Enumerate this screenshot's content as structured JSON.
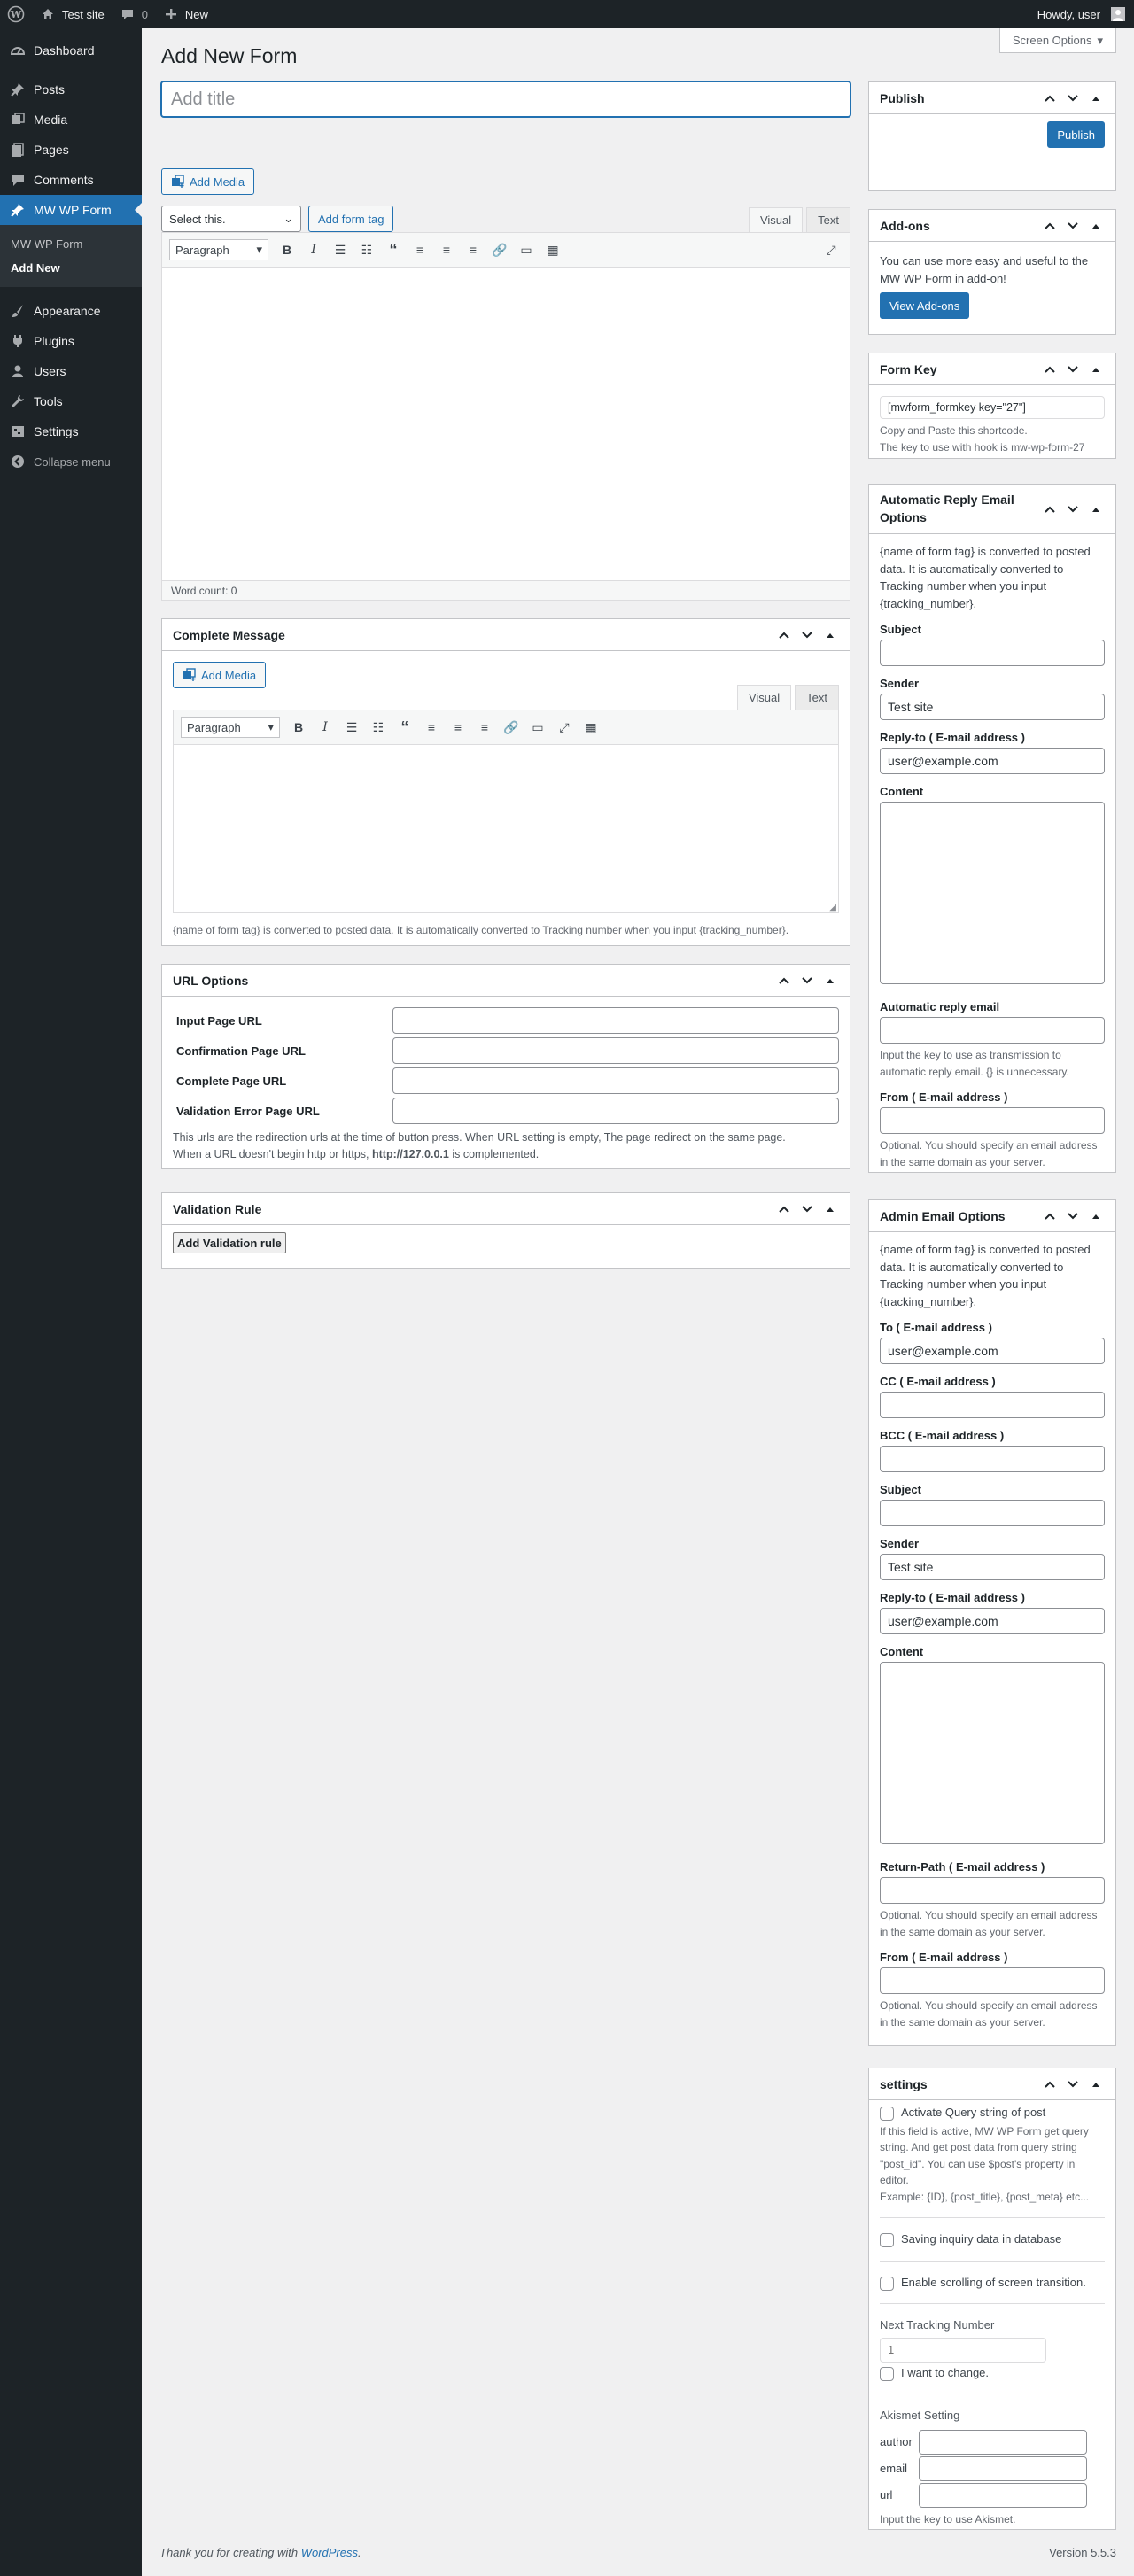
{
  "adminbar": {
    "site_name": "Test site",
    "comments_count": "0",
    "new_label": "New",
    "howdy": "Howdy, user"
  },
  "sidebar": {
    "items": [
      {
        "label": "Dashboard",
        "icon": "dashboard-icon"
      },
      {
        "label": "Posts",
        "icon": "pin-icon"
      },
      {
        "label": "Media",
        "icon": "media-icon"
      },
      {
        "label": "Pages",
        "icon": "page-icon"
      },
      {
        "label": "Comments",
        "icon": "comment-icon"
      },
      {
        "label": "MW WP Form",
        "icon": "pin-icon"
      },
      {
        "label": "Appearance",
        "icon": "brush-icon"
      },
      {
        "label": "Plugins",
        "icon": "plugin-icon"
      },
      {
        "label": "Users",
        "icon": "users-icon"
      },
      {
        "label": "Tools",
        "icon": "wrench-icon"
      },
      {
        "label": "Settings",
        "icon": "settings-icon"
      }
    ],
    "submenu": [
      "MW WP Form",
      "Add New"
    ],
    "collapse": "Collapse menu"
  },
  "page": {
    "screen_options": "Screen Options",
    "heading": "Add New Form",
    "title_placeholder": "Add title",
    "add_media": "Add Media",
    "select_placeholder": "Select this.",
    "add_form_tag": "Add form tag",
    "tab_visual": "Visual",
    "tab_text": "Text",
    "paragraph": "Paragraph",
    "word_count": "Word count: 0"
  },
  "complete_message": {
    "title": "Complete Message",
    "add_media": "Add Media",
    "tab_visual": "Visual",
    "tab_text": "Text",
    "paragraph": "Paragraph",
    "note": "{name of form tag} is converted to posted data. It is automatically converted to Tracking number when you input {tracking_number}."
  },
  "url_options": {
    "title": "URL Options",
    "rows": [
      "Input Page URL",
      "Confirmation Page URL",
      "Complete Page URL",
      "Validation Error Page URL"
    ],
    "note_1": "This urls are the redirection urls at the time of button press. When URL setting is empty, The page redirect on the same page.",
    "note_2": "When a URL doesn't begin http or https,",
    "note_host": "http://127.0.0.1",
    "note_3": "is complemented."
  },
  "validation": {
    "title": "Validation Rule",
    "button": "Add Validation rule"
  },
  "publish": {
    "title": "Publish",
    "button": "Publish"
  },
  "addons": {
    "title": "Add-ons",
    "text": "You can use more easy and useful to the MW WP Form in add-on!",
    "button": "View Add-ons"
  },
  "form_key": {
    "title": "Form Key",
    "value": "[mwform_formkey key=\"27\"]",
    "desc_1": "Copy and Paste this shortcode.",
    "desc_2": "The key to use with hook is mw-wp-form-27"
  },
  "auto_reply": {
    "title": "Automatic Reply Email Options",
    "intro": "{name of form tag} is converted to posted data. It is automatically converted to Tracking number when you input {tracking_number}.",
    "subject_label": "Subject",
    "subject_value": "",
    "sender_label": "Sender",
    "sender_value": "Test site",
    "reply_to_label": "Reply-to ( E-mail address )",
    "reply_to_value": "user@example.com",
    "content_label": "Content",
    "auto_email_label": "Automatic reply email",
    "auto_email_desc": "Input the key to use as transmission to automatic reply email. {} is unnecessary.",
    "from_label": "From ( E-mail address )",
    "from_desc": "Optional. You should specify an email address in the same domain as your server."
  },
  "admin_email": {
    "title": "Admin Email Options",
    "intro": "{name of form tag} is converted to posted data. It is automatically converted to Tracking number when you input {tracking_number}.",
    "to_label": "To ( E-mail address )",
    "to_value": "user@example.com",
    "cc_label": "CC ( E-mail address )",
    "bcc_label": "BCC ( E-mail address )",
    "subject_label": "Subject",
    "sender_label": "Sender",
    "sender_value": "Test site",
    "reply_to_label": "Reply-to ( E-mail address )",
    "reply_to_value": "user@example.com",
    "content_label": "Content",
    "return_path_label": "Return-Path ( E-mail address )",
    "return_path_desc": "Optional. You should specify an email address in the same domain as your server.",
    "from_label": "From ( E-mail address )",
    "from_desc": "Optional. You should specify an email address in the same domain as your server."
  },
  "settings": {
    "title": "settings",
    "query_label": "Activate Query string of post",
    "query_desc": "If this field is active, MW WP Form get query string. And get post data from query string \"post_id\". You can use $post's property in editor.",
    "query_example": "Example: {ID}, {post_title}, {post_meta} etc...",
    "db_label": "Saving inquiry data in database",
    "scroll_label": "Enable scrolling of screen transition.",
    "tracking_label": "Next Tracking Number",
    "tracking_placeholder": "1",
    "change_label": "I want to change.",
    "akismet_title": "Akismet Setting",
    "author": "author",
    "email": "email",
    "url": "url",
    "akismet_desc": "Input the key to use Akismet."
  },
  "footer": {
    "thanks": "Thank you for creating with",
    "link": "WordPress",
    "version": "Version 5.5.3"
  },
  "colors": {
    "accent": "#2271b1",
    "adminbar": "#1d2327"
  }
}
